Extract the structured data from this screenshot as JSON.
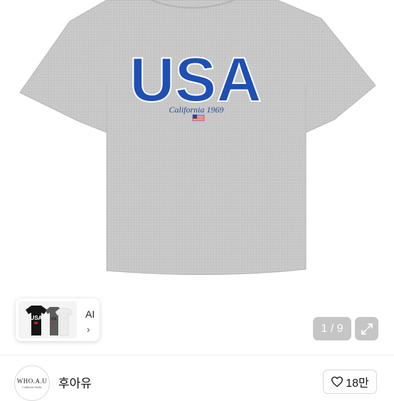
{
  "product": {
    "print_main": "USA",
    "print_script": "California 1969"
  },
  "gallery": {
    "counter": "1 / 9",
    "thumb_label": "AI",
    "thumb_chevron": "›",
    "thumb_print": "USA"
  },
  "seller": {
    "logo_text": "WHO.A.U",
    "logo_subtext": "California Studio",
    "name": "후아유"
  },
  "like": {
    "count": "18만"
  },
  "colors": {
    "shirt_gray": "#c9c9c9",
    "print_blue": "#1e4fb4",
    "overlay": "#969696"
  },
  "icons": [
    "expand-icon",
    "heart-icon",
    "chevron-right-icon",
    "flag-icon"
  ]
}
